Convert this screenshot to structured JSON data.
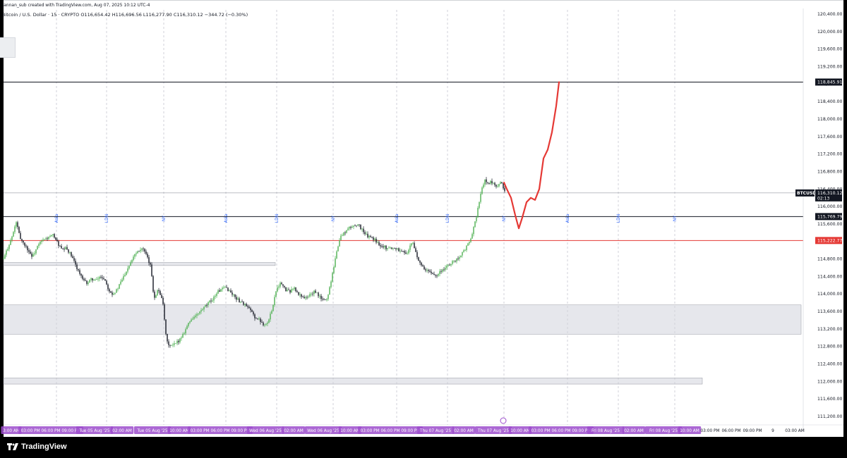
{
  "header": {
    "created_by": "fannan_sub created with TradingView.com, Aug 07, 2025 10:12 UTC-4",
    "symbol_line": "Bitcoin / U.S. Dollar · 15 · CRYPTO",
    "ohlc": {
      "open": "O116,654.42",
      "high": "H116,696.56",
      "low": "L116,277.90",
      "close": "C116,310.12",
      "change": "−344.72 (−0.30%)"
    }
  },
  "footer": {
    "brand": "TradingView"
  },
  "colors": {
    "up": "#26a69a",
    "up_green": "#4caf50",
    "down": "#131722",
    "drawing_red": "#e53935",
    "session_label": "#2962ff",
    "time_pill": "#9c4dcc",
    "zone": "#d1d4dc"
  },
  "chart_data": {
    "type": "candlestick",
    "symbol": "BTCUSD",
    "interval": "15",
    "y_ticks": [
      120400,
      120000,
      119600,
      119200,
      118800,
      118400,
      118000,
      117600,
      117200,
      116800,
      116400,
      116000,
      115600,
      115200,
      114800,
      114400,
      114000,
      113600,
      113200,
      112800,
      112400,
      112000,
      111600,
      111200
    ],
    "y_tick_labels": [
      "120,400.00",
      "120,000.00",
      "119,600.00",
      "119,200.00",
      "118,800.00",
      "118,400.00",
      "118,000.00",
      "117,600.00",
      "117,200.00",
      "116,800.00",
      "116,400.00",
      "116,000.00",
      "115,600.00",
      "115,200.00",
      "114,800.00",
      "114,400.00",
      "114,000.00",
      "113,600.00",
      "113,200.00",
      "112,800.00",
      "112,400.00",
      "112,000.00",
      "111,600.00",
      "111,200.00"
    ],
    "ylim": [
      111000,
      120500
    ],
    "price_lines": [
      {
        "label": "118,845.91",
        "value": 118845.91,
        "color": "#131722"
      },
      {
        "label": "115,769.79",
        "value": 115769.79,
        "color": "#131722"
      },
      {
        "label": "115,222.77",
        "value": 115222.77,
        "color": "#e53935"
      }
    ],
    "current_price": {
      "symbol": "BTCUSD",
      "label": "116,310.12",
      "countdown": "02:13",
      "value": 116310.12
    },
    "session_labels": [
      {
        "text": "Asia",
        "x": 80
      },
      {
        "text": "LDN",
        "x": 151
      },
      {
        "text": "NY",
        "x": 232
      },
      {
        "text": "Asia",
        "x": 320
      },
      {
        "text": "LDN",
        "x": 392
      },
      {
        "text": "NY",
        "x": 472
      },
      {
        "text": "Asia",
        "x": 562
      },
      {
        "text": "LDN",
        "x": 634
      },
      {
        "text": "NY",
        "x": 714
      },
      {
        "text": "Asia",
        "x": 804
      },
      {
        "text": "LDN",
        "x": 876
      },
      {
        "text": "NY",
        "x": 956
      }
    ],
    "zones": [
      {
        "from": 114720,
        "to": 114650,
        "x0": 5,
        "x1": 390
      },
      {
        "from": 113750,
        "to": 113080,
        "x0": 5,
        "x1": 1135
      },
      {
        "from": 112080,
        "to": 111940,
        "x0": 5,
        "x1": 995
      }
    ],
    "time_labels": [
      {
        "text": "3:00 AM",
        "x": 16,
        "pill": true
      },
      {
        "text": "03:00 PM 06:00 PM 09:00 PM",
        "x": 72,
        "pill": true
      },
      {
        "text": "Tue 05 Aug '25",
        "x": 134,
        "pill": true
      },
      {
        "text": "02:00 AM",
        "x": 173,
        "pill": true
      },
      {
        "text": "Tue 05 Aug '25",
        "x": 216,
        "pill": true
      },
      {
        "text": "10:00 AM",
        "x": 254,
        "pill": true
      },
      {
        "text": "03:00 PM 06:00 PM 09:00 PM",
        "x": 312,
        "pill": true
      },
      {
        "text": "Wed 06 Aug '25",
        "x": 376,
        "pill": true
      },
      {
        "text": "02:00 AM",
        "x": 416,
        "pill": true
      },
      {
        "text": "Wed 06 Aug '25",
        "x": 458,
        "pill": true
      },
      {
        "text": "10:00 AM",
        "x": 496,
        "pill": true
      },
      {
        "text": "03:00 PM 06:00 PM 09:00 PM",
        "x": 553,
        "pill": true
      },
      {
        "text": "Thu 07 Aug '25",
        "x": 617,
        "pill": true
      },
      {
        "text": "02:00 AM",
        "x": 657,
        "pill": true
      },
      {
        "text": "Thu 07 Aug '25",
        "x": 699,
        "pill": true
      },
      {
        "text": "10:00 AM",
        "x": 737,
        "pill": true
      },
      {
        "text": "03:00 PM 06:00 PM 09:00 PM",
        "x": 795,
        "pill": true
      },
      {
        "text": "Fri 08 Aug '25",
        "x": 858,
        "pill": true
      },
      {
        "text": "02:00 AM",
        "x": 898,
        "pill": true
      },
      {
        "text": "Fri 08 Aug '25",
        "x": 940,
        "pill": true
      },
      {
        "text": "10:00 AM",
        "x": 977,
        "pill": true
      },
      {
        "text": "03:00 PM",
        "x": 1006,
        "pill": false
      },
      {
        "text": "06:00 PM",
        "x": 1036,
        "pill": false
      },
      {
        "text": "09:00 PM",
        "x": 1066,
        "pill": false
      },
      {
        "text": "9",
        "x": 1095,
        "pill": false
      },
      {
        "text": "03:00 AM",
        "x": 1126,
        "pill": false
      }
    ],
    "series": [
      {
        "name": "BTCUSD",
        "close_path_x": [
          5,
          12,
          18,
          23,
          28,
          34,
          40,
          46,
          52,
          58,
          64,
          70,
          76,
          82,
          88,
          94,
          100,
          106,
          112,
          118,
          124,
          130,
          136,
          142,
          148,
          154,
          160,
          166,
          172,
          178,
          184,
          190,
          196,
          202,
          208,
          214,
          218,
          224,
          230,
          236,
          242,
          248,
          254,
          260,
          266,
          272,
          278,
          284,
          290,
          296,
          302,
          308,
          314,
          320,
          326,
          332,
          338,
          344,
          350,
          356,
          362,
          368,
          374,
          380,
          386,
          392,
          398,
          404,
          410,
          416,
          422,
          428,
          434,
          440,
          446,
          452,
          458,
          464,
          470,
          476,
          482,
          488,
          494,
          500,
          506,
          512,
          518,
          524,
          530,
          536,
          542,
          548,
          554,
          560,
          566,
          572,
          578,
          584,
          590,
          596,
          602,
          608,
          614,
          620,
          626,
          632,
          638,
          644,
          650,
          656,
          662,
          668,
          674,
          680,
          686,
          692,
          698,
          704,
          710,
          716
        ],
        "close_path": [
          114800,
          115100,
          115350,
          115650,
          115300,
          115150,
          115000,
          114850,
          115050,
          115200,
          115250,
          115300,
          115350,
          115150,
          115000,
          115050,
          114900,
          114700,
          114500,
          114300,
          114250,
          114350,
          114300,
          114400,
          114350,
          114100,
          114000,
          114100,
          114300,
          114500,
          114700,
          114900,
          115000,
          115050,
          114850,
          114600,
          113900,
          114100,
          113900,
          112900,
          112800,
          112850,
          112950,
          113100,
          113300,
          113450,
          113500,
          113600,
          113700,
          113800,
          113900,
          114050,
          114100,
          114150,
          114050,
          113950,
          113850,
          113800,
          113700,
          113600,
          113450,
          113400,
          113300,
          113350,
          113700,
          114150,
          114250,
          114100,
          114050,
          114150,
          114000,
          113950,
          113900,
          114000,
          114050,
          113950,
          113850,
          113900,
          114400,
          114900,
          115300,
          115400,
          115500,
          115550,
          115600,
          115500,
          115350,
          115300,
          115250,
          115150,
          115100,
          115050,
          115050,
          115050,
          115000,
          114950,
          114950,
          115200,
          114900,
          114650,
          114550,
          114500,
          114450,
          114450,
          114550,
          114600,
          114700,
          114750,
          114850,
          114950,
          115100,
          115300,
          115700,
          116200,
          116600,
          116550,
          116550,
          116400,
          116600,
          116300
        ]
      },
      {
        "name": "projection",
        "x": [
          714,
          718,
          724,
          730,
          735,
          740,
          746,
          752,
          758,
          764,
          770,
          776,
          782,
          788,
          792
        ],
        "values": [
          116550,
          116400,
          116200,
          115800,
          115500,
          115750,
          116100,
          116200,
          116150,
          116400,
          117100,
          117300,
          117700,
          118300,
          118845
        ]
      }
    ]
  }
}
